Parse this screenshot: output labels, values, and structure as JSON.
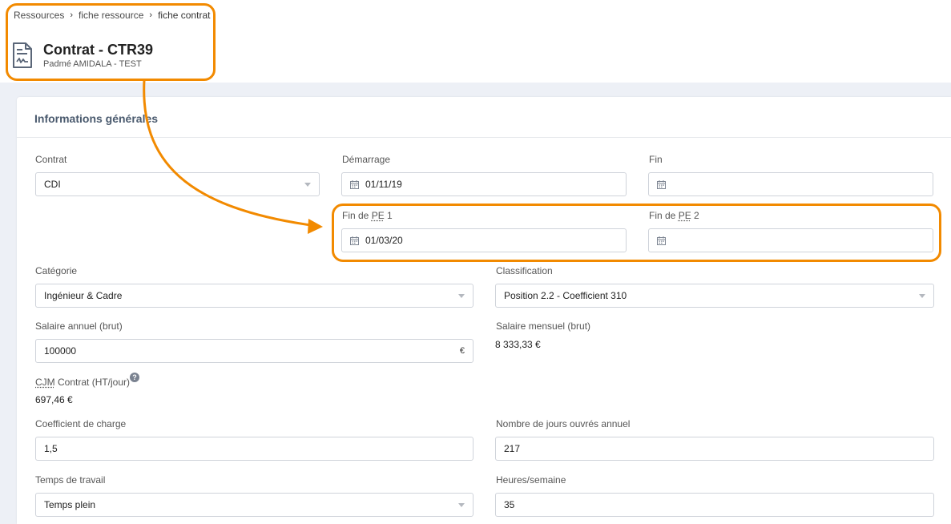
{
  "breadcrumb": {
    "items": [
      "Ressources",
      "fiche ressource",
      "fiche contrat"
    ],
    "separator": "›"
  },
  "header": {
    "icon": "contract-document-icon",
    "title": "Contrat - CTR39",
    "subtitle": "Padmé AMIDALA - TEST"
  },
  "section": {
    "title": "Informations générales"
  },
  "form": {
    "contrat": {
      "label": "Contrat",
      "value": "CDI"
    },
    "demarrage": {
      "label": "Démarrage",
      "value": "01/11/19"
    },
    "fin": {
      "label": "Fin",
      "value": ""
    },
    "fin_pe1": {
      "label_prefix": "Fin de ",
      "abbr": "PE",
      "label_suffix": " 1",
      "value": "01/03/20"
    },
    "fin_pe2": {
      "label_prefix": "Fin de ",
      "abbr": "PE",
      "label_suffix": " 2",
      "value": ""
    },
    "categorie": {
      "label": "Catégorie",
      "value": "Ingénieur & Cadre"
    },
    "classification": {
      "label": "Classification",
      "value": "Position 2.2 - Coefficient 310"
    },
    "salaire_annuel": {
      "label": "Salaire annuel (brut)",
      "value": "100000",
      "unit": "€"
    },
    "salaire_mensuel": {
      "label": "Salaire mensuel (brut)",
      "value": "8 333,33 €"
    },
    "cjm": {
      "abbr": "CJM",
      "label_suffix": " Contrat (HT/jour)",
      "help": "?",
      "value": "697,46 €"
    },
    "coefficient_charge": {
      "label": "Coefficient de charge",
      "value": "1,5"
    },
    "jours_ouvres": {
      "label": "Nombre de jours ouvrés annuel",
      "value": "217"
    },
    "temps_travail": {
      "label": "Temps de travail",
      "value": "Temps plein"
    },
    "heures_semaine": {
      "label": "Heures/semaine",
      "value": "35"
    }
  },
  "colors": {
    "highlight": "#f28a00",
    "background": "#edf0f6",
    "section_title": "#4a5a6e"
  }
}
